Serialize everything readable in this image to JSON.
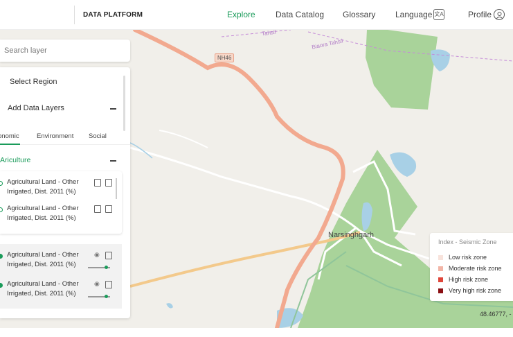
{
  "header": {
    "brand": "DATA PLATFORM",
    "nav": [
      {
        "label": "Explore",
        "active": true
      },
      {
        "label": "Data Catalog",
        "active": false
      },
      {
        "label": "Glossary",
        "active": false
      },
      {
        "label": "Language",
        "active": false
      },
      {
        "label": "Profile",
        "active": false
      }
    ],
    "language_icon": "translate-icon",
    "profile_icon": "user-icon"
  },
  "search": {
    "placeholder": "Search layer"
  },
  "panel": {
    "select_region": "Select Region",
    "add_layers": "Add Data Layers",
    "tabs": [
      "onomic",
      "Environment",
      "Social"
    ],
    "category": "ricultur",
    "layer_list": [
      {
        "label": "Agricultural Land - Other Irrigated, Dist. 2011 (%)"
      },
      {
        "label": "Agricultural Land - Other Irrigated, Dist. 2011 (%)"
      }
    ],
    "active_layers": [
      {
        "label": "Agricultural Land - Other Irrigated, Dist. 2011 (%)",
        "opacity": 0.85
      },
      {
        "label": "Agricultural Land - Other Irrigated, Dist. 2011 (%)",
        "opacity": 0.85
      }
    ]
  },
  "map": {
    "labels": {
      "road": "NH46",
      "tahsil": "Biaora Tahsil",
      "town": "Narsinghgarh",
      "boundary": "Tahsil"
    },
    "coordinates": "48.46777, -"
  },
  "legend": {
    "title": "Index - Seismic Zone",
    "items": [
      {
        "label": "Low risk zone",
        "color": "#f8e3dc"
      },
      {
        "label": "Moderate risk zone",
        "color": "#f2b5a7"
      },
      {
        "label": "High risk zone",
        "color": "#e0453a"
      },
      {
        "label": "Very high risk zone",
        "color": "#8b0f13"
      }
    ]
  },
  "colors": {
    "accent": "#1a9b5a",
    "forest": "#a9d39a",
    "water": "#a8d0e6",
    "highway": "#f2a98f"
  }
}
